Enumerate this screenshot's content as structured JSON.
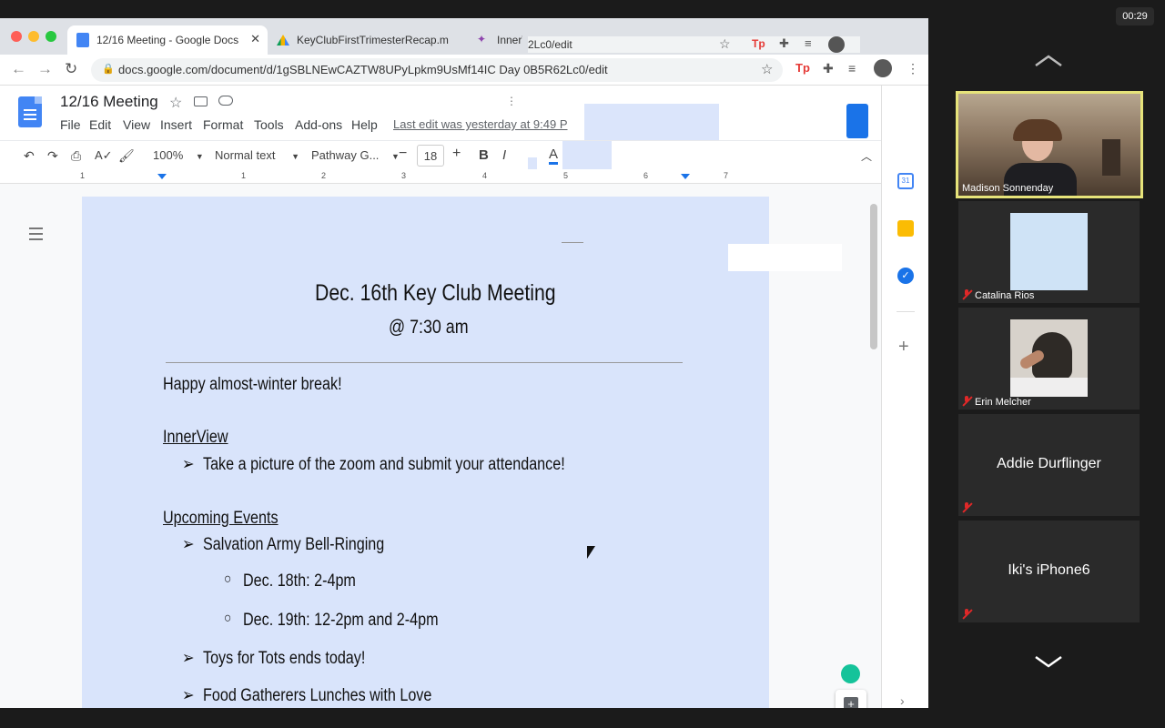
{
  "zoom": {
    "timer": "00:29",
    "participants": [
      {
        "name": "Madison Sonnenday",
        "muted": false,
        "video": true
      },
      {
        "name": "Catalina Rios",
        "muted": true,
        "video": false
      },
      {
        "name": "Erin Melcher",
        "muted": true,
        "video": false
      },
      {
        "name": "Addie Durflinger",
        "muted": true,
        "video": false
      },
      {
        "name": "Iki's iPhone6",
        "muted": true,
        "video": false
      }
    ]
  },
  "browser": {
    "tabs": [
      {
        "label": "12/16 Meeting - Google Docs",
        "active": true
      },
      {
        "label": "KeyClubFirstTrimesterRecap.m",
        "active": false
      },
      {
        "label": "InnerV",
        "active": false
      }
    ],
    "overlay_url": "2Lc0/edit",
    "url": "docs.google.com/document/d/1gSBLNEwCAZTW8UPyLpkm9UsMf14IC Day 0B5R62Lc0/edit"
  },
  "docs": {
    "title": "12/16 Meeting",
    "menu": [
      "File",
      "Edit",
      "View",
      "Insert",
      "Format",
      "Tools",
      "Add-ons",
      "Help"
    ],
    "last_edit": "Last edit was yesterday at 9:49 P",
    "toolbar": {
      "zoom": "100%",
      "style": "Normal text",
      "font": "Pathway G...",
      "size": "18"
    },
    "ruler_numbers": [
      "1",
      "1",
      "2",
      "3",
      "4",
      "5",
      "6",
      "7"
    ],
    "content": {
      "title": "Dec. 16th Key Club Meeting",
      "time": "@ 7:30 am",
      "greeting": "Happy almost-winter break!",
      "innerview_heading": "InnerView",
      "innerview_item": "Take a picture of the zoom and submit your attendance!",
      "upcoming_heading": "Upcoming Events",
      "event1": "Salvation Army Bell-Ringing",
      "event1_sub1": "Dec. 18th: 2-4pm",
      "event1_sub2": "Dec. 19th: 12-2pm and 2-4pm",
      "event2": "Toys for Tots ends today!",
      "event3": "Food Gatherers Lunches with Love"
    }
  },
  "colors": {
    "docs_blue": "#4285f4",
    "page_bg": "#d9e4fb",
    "active_speaker": "#e6e37a"
  }
}
